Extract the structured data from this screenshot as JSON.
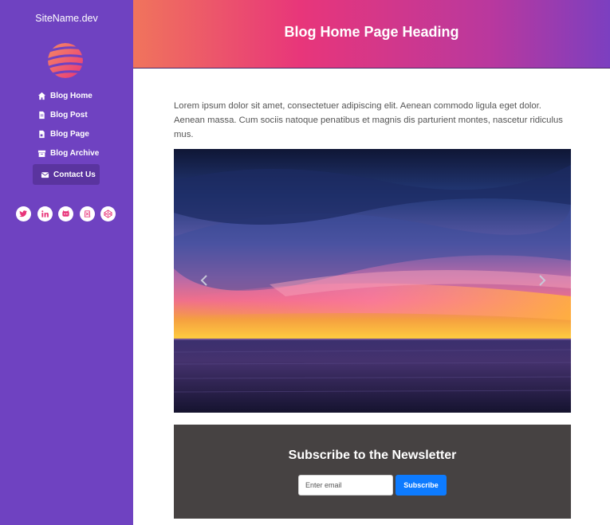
{
  "sidebar": {
    "site_name": "SiteName.dev",
    "logo_icon": "striped-globe-logo",
    "nav_items": [
      {
        "label": "Blog Home",
        "icon": "home-icon",
        "active": false
      },
      {
        "label": "Blog Post",
        "icon": "document-icon",
        "active": false
      },
      {
        "label": "Blog Page",
        "icon": "page-icon",
        "active": false
      },
      {
        "label": "Blog Archive",
        "icon": "archive-icon",
        "active": false
      },
      {
        "label": "Contact Us",
        "icon": "envelope-icon",
        "active": true
      }
    ],
    "social": [
      "twitter-icon",
      "linkedin-icon",
      "github-icon",
      "dribbble-icon",
      "codepen-icon"
    ]
  },
  "header": {
    "title": "Blog Home Page Heading"
  },
  "main": {
    "intro": "Lorem ipsum dolor sit amet, consectetuer adipiscing elit. Aenean commodo ligula eget dolor. Aenean massa. Cum sociis natoque penatibus et magnis dis parturient montes, nascetur ridiculus mus."
  },
  "newsletter": {
    "title": "Subscribe to the Newsletter",
    "email_placeholder": "Enter email",
    "button_label": "Subscribe"
  },
  "colors": {
    "sidebar": "#6f42c1",
    "accent_button": "#0d7bff",
    "icon_pink": "#e8367a",
    "newsletter_bg": "#464242"
  }
}
